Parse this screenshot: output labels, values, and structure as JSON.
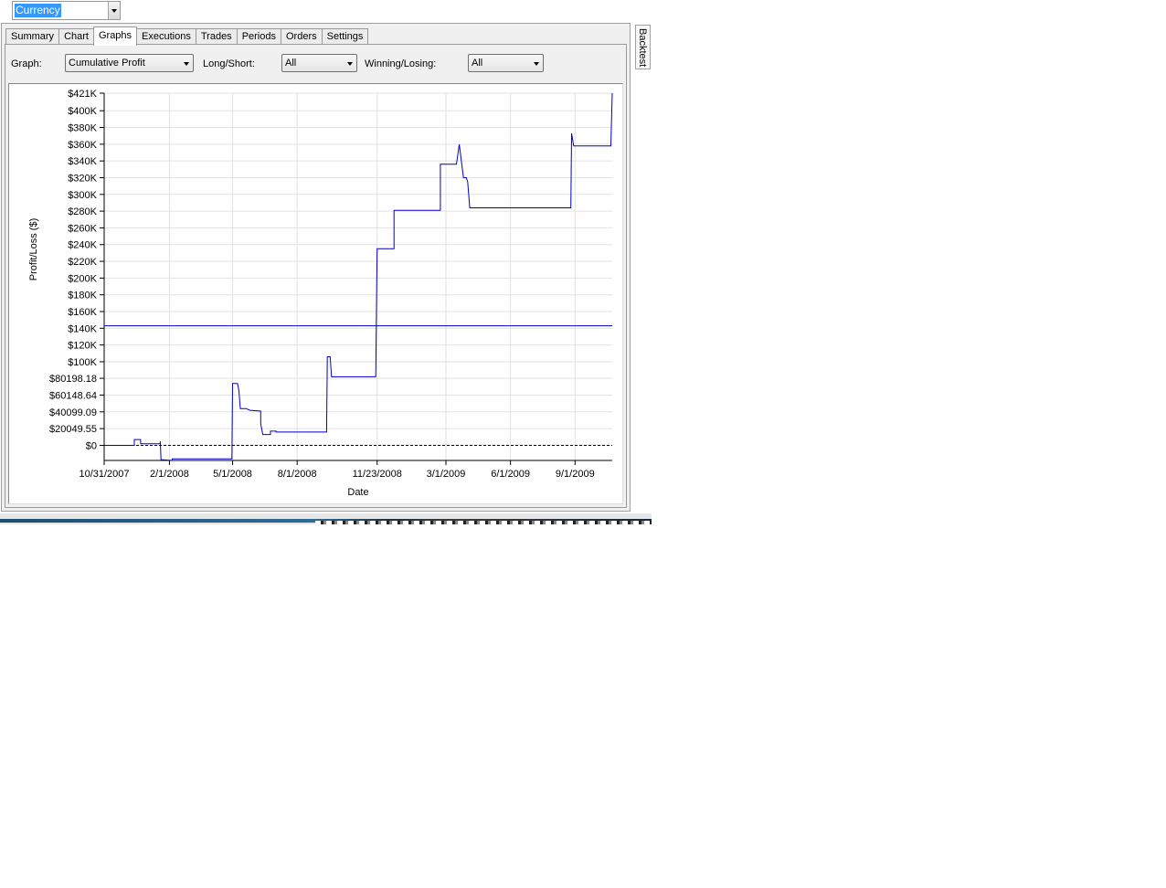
{
  "top_select": {
    "value": "Currency"
  },
  "tabs": [
    "Summary",
    "Chart",
    "Graphs",
    "Executions",
    "Trades",
    "Periods",
    "Orders",
    "Settings"
  ],
  "active_tab": "Graphs",
  "controls": {
    "graph_label": "Graph:",
    "graph_value": "Cumulative Profit",
    "longshort_label": "Long/Short:",
    "longshort_value": "All",
    "winlose_label": "Winning/Losing:",
    "winlose_value": "All"
  },
  "side_tab": "Backtest",
  "chart_data": {
    "type": "line",
    "xlabel": "Date",
    "ylabel": "Profit/Loss ($)",
    "x_ticks": [
      "10/31/2007",
      "2/1/2008",
      "5/1/2008",
      "8/1/2008",
      "11/23/2008",
      "3/1/2009",
      "6/1/2009",
      "9/1/2009"
    ],
    "y_ticks": [
      "$421K",
      "$400K",
      "$380K",
      "$360K",
      "$340K",
      "$320K",
      "$300K",
      "$280K",
      "$260K",
      "$240K",
      "$220K",
      "$200K",
      "$180K",
      "$160K",
      "$140K",
      "$120K",
      "$100K",
      "$80198.18",
      "$60148.64",
      "$40099.09",
      "$20049.55",
      "$0"
    ],
    "ylim": [
      -18000,
      421000
    ],
    "grid": true,
    "average_line": 143000,
    "zero_line": 0,
    "series": [
      {
        "color": "#0000cc",
        "points": [
          [
            "2007-10-31",
            0
          ],
          [
            "2007-12-13",
            0
          ],
          [
            "2007-12-13",
            7000
          ],
          [
            "2007-12-22",
            7000
          ],
          [
            "2007-12-22",
            2000
          ],
          [
            "2008-01-19",
            2000
          ],
          [
            "2008-01-19",
            5000
          ],
          [
            "2008-01-20",
            -17000
          ],
          [
            "2008-02-05",
            -18000
          ],
          [
            "2008-02-05",
            -16000
          ],
          [
            "2008-04-30",
            -16000
          ],
          [
            "2008-05-01",
            74000
          ],
          [
            "2008-05-08",
            74000
          ],
          [
            "2008-05-10",
            66000
          ],
          [
            "2008-05-12",
            44000
          ],
          [
            "2008-05-20",
            44000
          ],
          [
            "2008-05-26",
            42000
          ],
          [
            "2008-06-10",
            41000
          ],
          [
            "2008-06-10",
            26000
          ],
          [
            "2008-06-13",
            13000
          ],
          [
            "2008-06-24",
            13000
          ],
          [
            "2008-06-24",
            17000
          ],
          [
            "2008-07-02",
            17000
          ],
          [
            "2008-07-02",
            16000
          ],
          [
            "2008-09-12",
            16000
          ],
          [
            "2008-09-13",
            106000
          ],
          [
            "2008-09-17",
            106000
          ],
          [
            "2008-09-19",
            82000
          ],
          [
            "2008-11-21",
            82000
          ],
          [
            "2008-11-23",
            235000
          ],
          [
            "2008-12-17",
            235000
          ],
          [
            "2008-12-17",
            281000
          ],
          [
            "2009-02-21",
            281000
          ],
          [
            "2009-02-21",
            336000
          ],
          [
            "2009-03-16",
            336000
          ],
          [
            "2009-03-20",
            360000
          ],
          [
            "2009-03-23",
            340000
          ],
          [
            "2009-03-26",
            320000
          ],
          [
            "2009-03-30",
            320000
          ],
          [
            "2009-04-01",
            315000
          ],
          [
            "2009-04-04",
            284000
          ],
          [
            "2009-08-26",
            284000
          ],
          [
            "2009-08-27",
            373000
          ],
          [
            "2009-08-30",
            358000
          ],
          [
            "2009-10-22",
            358000
          ],
          [
            "2009-10-24",
            421000
          ]
        ]
      }
    ]
  }
}
